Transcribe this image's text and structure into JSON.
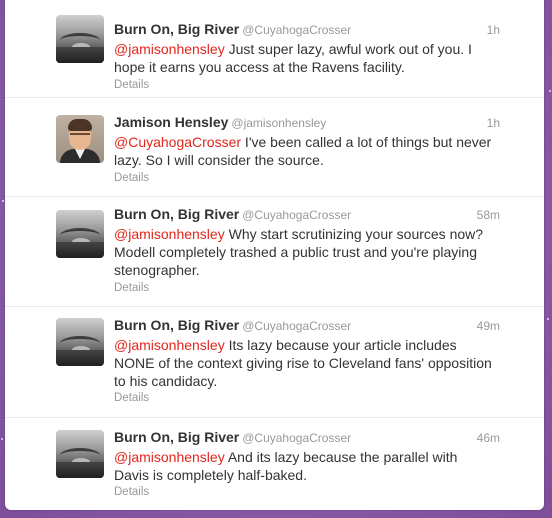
{
  "tweets": [
    {
      "fullname": "Burn On, Big River",
      "username": "@CuyahogaCrosser",
      "time": "1h",
      "mention": "@jamisonhensley",
      "body": " Just super lazy, awful work out of you. I hope it earns you access at the Ravens facility.",
      "details": "Details",
      "avatar": "river-bridge-avatar"
    },
    {
      "fullname": "Jamison Hensley",
      "username": "@jamisonhensley",
      "time": "1h",
      "mention": "@CuyahogaCrosser",
      "body": " I've been called a lot of things but never lazy. So I will consider the source.",
      "details": "Details",
      "avatar": "person-photo-avatar"
    },
    {
      "fullname": "Burn On, Big River",
      "username": "@CuyahogaCrosser",
      "time": "58m",
      "mention": "@jamisonhensley",
      "body": " Why start scrutinizing your sources now? Modell completely trashed a public trust and you're playing stenographer.",
      "details": "Details",
      "avatar": "river-bridge-avatar"
    },
    {
      "fullname": "Burn On, Big River",
      "username": "@CuyahogaCrosser",
      "time": "49m",
      "mention": "@jamisonhensley",
      "body": " Its lazy because your article includes NONE of the context giving rise to Cleveland fans' opposition to his candidacy.",
      "details": "Details",
      "avatar": "river-bridge-avatar"
    },
    {
      "fullname": "Burn On, Big River",
      "username": "@CuyahogaCrosser",
      "time": "46m",
      "mention": "@jamisonhensley",
      "body": " And its lazy because the parallel with Davis is completely half-baked.",
      "details": "Details",
      "avatar": "river-bridge-avatar"
    }
  ],
  "colors": {
    "mention": "#e0261b",
    "name": "#333333",
    "muted": "#999999",
    "background": "#8a5aa6"
  }
}
